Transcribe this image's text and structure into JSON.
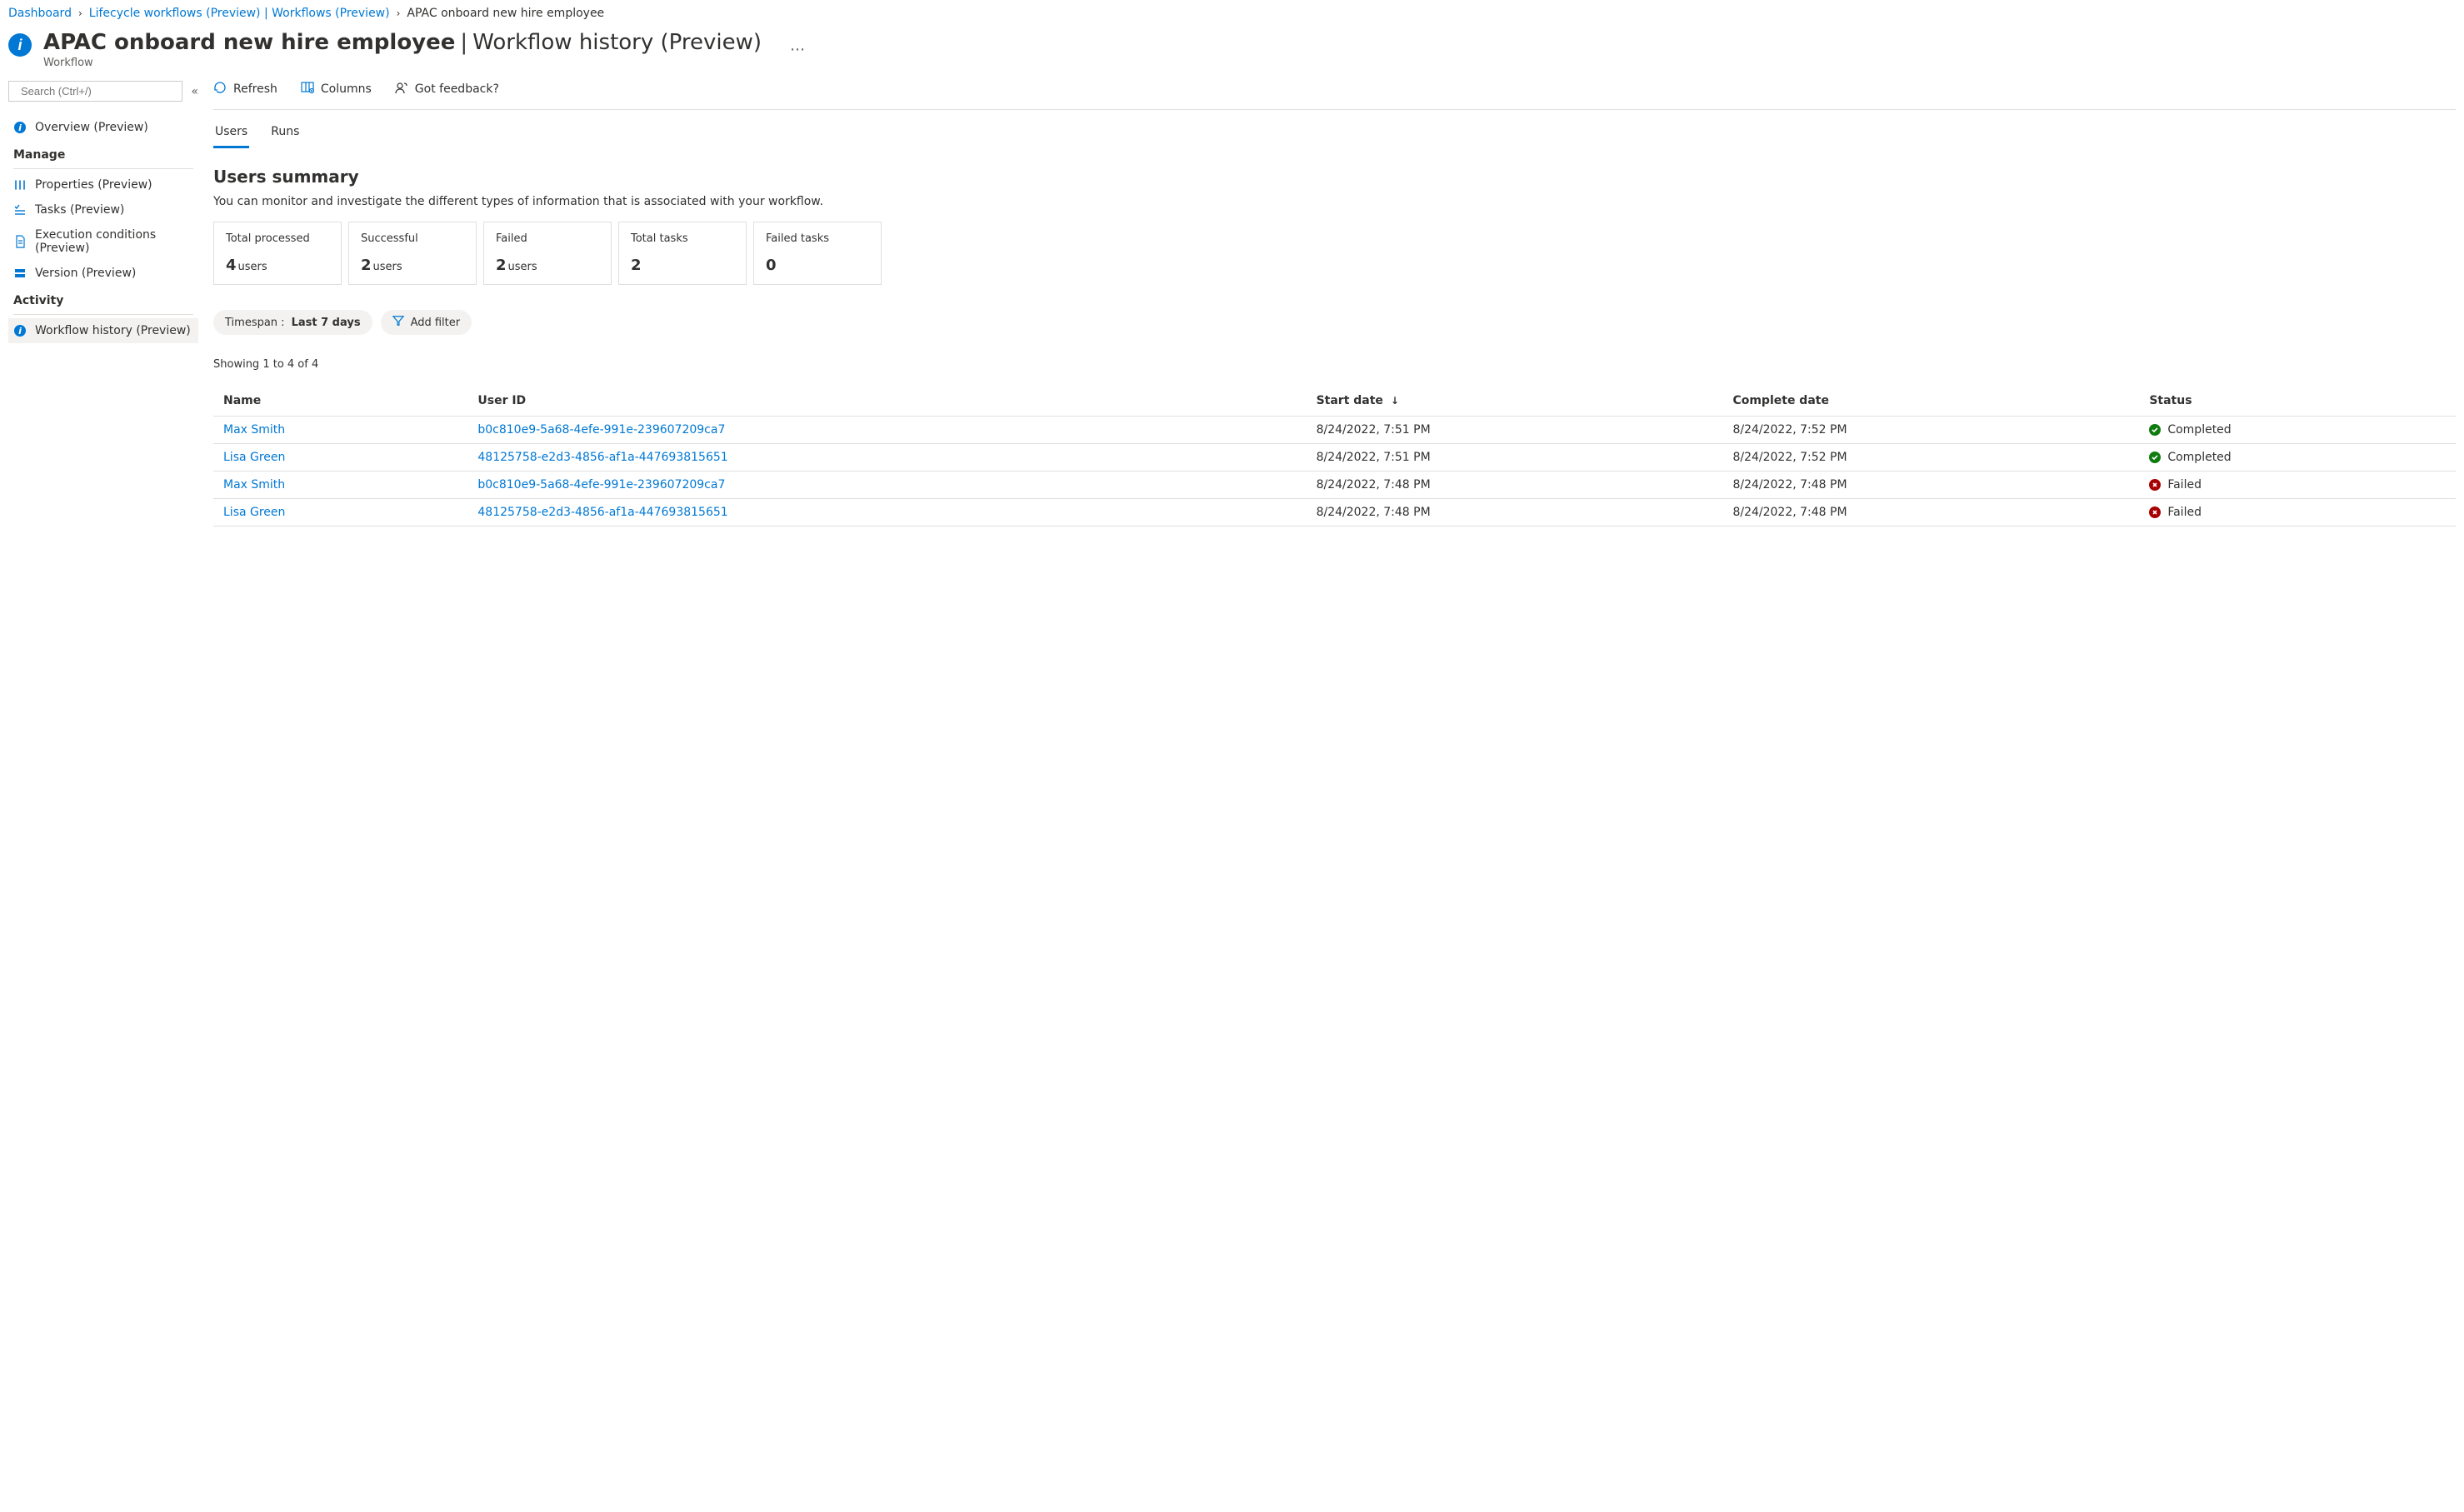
{
  "breadcrumb": {
    "items": [
      {
        "label": "Dashboard",
        "link": true
      },
      {
        "label": "Lifecycle workflows (Preview) | Workflows (Preview)",
        "link": true
      },
      {
        "label": "APAC onboard new hire employee",
        "link": false
      }
    ]
  },
  "header": {
    "title": "APAC onboard new hire employee",
    "separator": " | ",
    "subtitle": "Workflow history (Preview)",
    "caption": "Workflow"
  },
  "search": {
    "placeholder": "Search (Ctrl+/)"
  },
  "nav": {
    "overview": "Overview (Preview)",
    "manage_label": "Manage",
    "manage_items": [
      {
        "icon": "properties",
        "label": "Properties (Preview)"
      },
      {
        "icon": "tasks",
        "label": "Tasks (Preview)"
      },
      {
        "icon": "execution",
        "label": "Execution conditions (Preview)"
      },
      {
        "icon": "version",
        "label": "Version (Preview)"
      }
    ],
    "activity_label": "Activity",
    "activity_items": [
      {
        "icon": "history",
        "label": "Workflow history (Preview)",
        "selected": true
      }
    ]
  },
  "toolbar": {
    "refresh": "Refresh",
    "columns": "Columns",
    "feedback": "Got feedback?"
  },
  "tabs": {
    "users": "Users",
    "runs": "Runs"
  },
  "summary": {
    "title": "Users summary",
    "desc": "You can monitor and investigate the different types of information that is associated with your workflow.",
    "cards": [
      {
        "label": "Total processed",
        "value": "4",
        "unit": "users"
      },
      {
        "label": "Successful",
        "value": "2",
        "unit": "users"
      },
      {
        "label": "Failed",
        "value": "2",
        "unit": "users"
      },
      {
        "label": "Total tasks",
        "value": "2",
        "unit": ""
      },
      {
        "label": "Failed tasks",
        "value": "0",
        "unit": ""
      }
    ]
  },
  "filters": {
    "timespan_label": "Timespan : ",
    "timespan_value": "Last 7 days",
    "add_filter": "Add filter"
  },
  "showing": "Showing 1 to 4 of 4",
  "table": {
    "columns": {
      "name": "Name",
      "userid": "User ID",
      "start": "Start date",
      "complete": "Complete date",
      "status": "Status"
    },
    "rows": [
      {
        "name": "Max Smith",
        "userid": "b0c810e9-5a68-4efe-991e-239607209ca7",
        "start": "8/24/2022, 7:51 PM",
        "complete": "8/24/2022, 7:52 PM",
        "status": "Completed",
        "ok": true
      },
      {
        "name": "Lisa Green",
        "userid": "48125758-e2d3-4856-af1a-447693815651",
        "start": "8/24/2022, 7:51 PM",
        "complete": "8/24/2022, 7:52 PM",
        "status": "Completed",
        "ok": true
      },
      {
        "name": "Max Smith",
        "userid": "b0c810e9-5a68-4efe-991e-239607209ca7",
        "start": "8/24/2022, 7:48 PM",
        "complete": "8/24/2022, 7:48 PM",
        "status": "Failed",
        "ok": false
      },
      {
        "name": "Lisa Green",
        "userid": "48125758-e2d3-4856-af1a-447693815651",
        "start": "8/24/2022, 7:48 PM",
        "complete": "8/24/2022, 7:48 PM",
        "status": "Failed",
        "ok": false
      }
    ]
  }
}
